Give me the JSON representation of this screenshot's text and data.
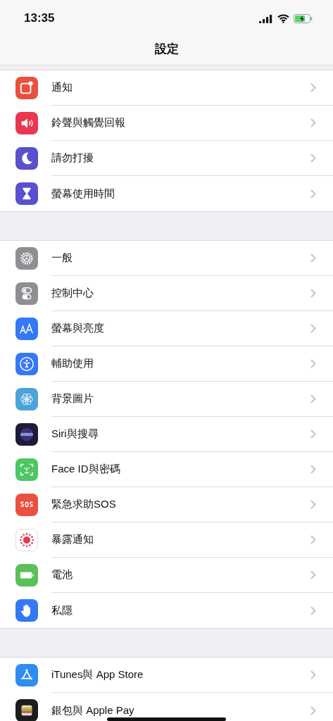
{
  "status_bar": {
    "time": "13:35"
  },
  "nav": {
    "title": "設定"
  },
  "groups": [
    {
      "items": [
        {
          "label": "通知",
          "kind": "notifications",
          "color": "#e9503f"
        },
        {
          "label": "鈴聲與觸覺回報",
          "kind": "sounds",
          "color": "#e8384f"
        },
        {
          "label": "請勿打擾",
          "kind": "moon",
          "color": "#5a4fcf"
        },
        {
          "label": "螢幕使用時間",
          "kind": "hourglass",
          "color": "#5a4fcf"
        }
      ]
    },
    {
      "items": [
        {
          "label": "一般",
          "kind": "gear",
          "color": "#8e8e93"
        },
        {
          "label": "控制中心",
          "kind": "toggles",
          "color": "#8e8e93"
        },
        {
          "label": "螢幕與亮度",
          "kind": "text",
          "color": "#3478f6"
        },
        {
          "label": "輔助使用",
          "kind": "accessibility",
          "color": "#3478f6"
        },
        {
          "label": "背景圖片",
          "kind": "flower",
          "color": "#4aa3d9"
        },
        {
          "label": "Siri與搜尋",
          "kind": "siri",
          "color": "#1c1c3a"
        },
        {
          "label": "Face ID與密碼",
          "kind": "face",
          "color": "#4cc764"
        },
        {
          "label": "緊急求助SOS",
          "kind": "sos",
          "color": "#e9503f"
        },
        {
          "label": "暴露通知",
          "kind": "exposure",
          "color": "#ffffff"
        },
        {
          "label": "電池",
          "kind": "battery",
          "color": "#5ac05a"
        },
        {
          "label": "私隱",
          "kind": "hand",
          "color": "#3478f6"
        }
      ]
    },
    {
      "items": [
        {
          "label": "iTunes與 App Store",
          "kind": "appstore",
          "color": "#2f8cf3"
        },
        {
          "label": "銀包與 Apple Pay",
          "kind": "wallet",
          "color": "#1c1c1e"
        }
      ]
    }
  ]
}
